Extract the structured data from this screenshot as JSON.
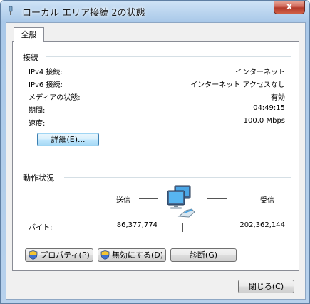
{
  "window": {
    "title": "ローカル エリア接続 2の状態",
    "close_label": "x"
  },
  "tabs": [
    "全般"
  ],
  "connection": {
    "header": "接続",
    "rows": [
      {
        "label": "IPv4 接続:",
        "value": "インターネット"
      },
      {
        "label": "IPv6 接続:",
        "value": "インターネット アクセスなし"
      },
      {
        "label": "メディアの状態:",
        "value": "有効"
      },
      {
        "label": "期間:",
        "value": "04:49:15"
      },
      {
        "label": "速度:",
        "value": "100.0 Mbps"
      }
    ],
    "details_button": "詳細(E)..."
  },
  "activity": {
    "header": "動作状況",
    "sent_label": "送信",
    "received_label": "受信",
    "bytes_label": "バイト:",
    "bytes_sent": "86,377,774",
    "bytes_received": "202,362,144"
  },
  "buttons": {
    "properties": "プロパティ(P)",
    "disable": "無効にする(D)",
    "diagnose": "診断(G)",
    "close": "閉じる(C)"
  },
  "icons": {
    "title": "network-adapter-icon",
    "network": "network-computers-icon",
    "uac": "uac-shield-icon"
  }
}
